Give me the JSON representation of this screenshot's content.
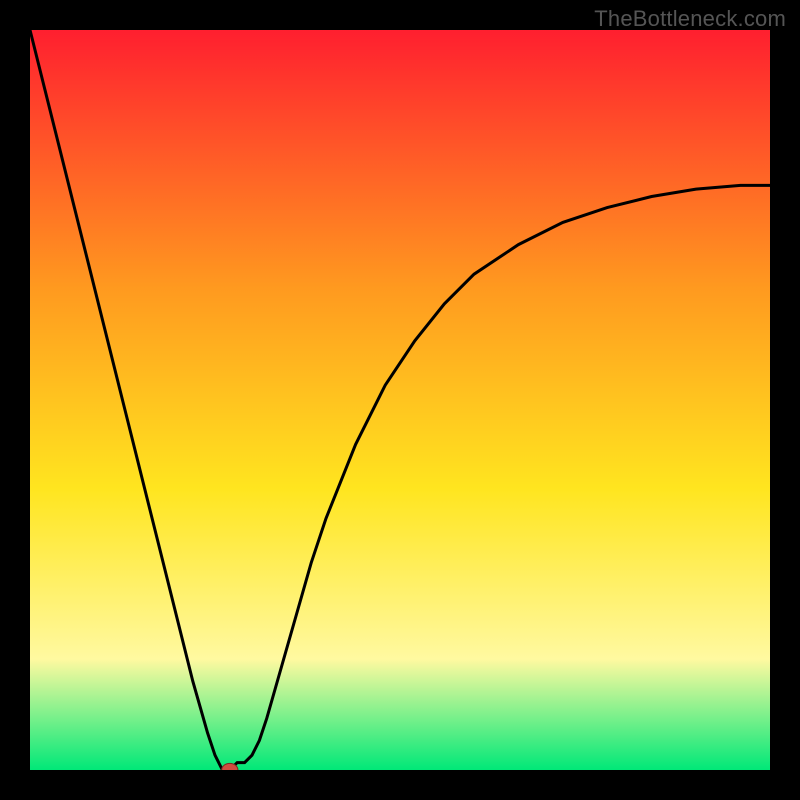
{
  "watermark": "TheBottleneck.com",
  "colors": {
    "frame": "#000000",
    "curve": "#000000",
    "marker_fill": "#cf4d3f",
    "marker_stroke": "#7a2a20",
    "gradient_top": "#ff1f2f",
    "gradient_mid_upper": "#ff9a1f",
    "gradient_mid": "#ffe51f",
    "gradient_mid_lower": "#fff9a0",
    "gradient_bottom": "#00e878"
  },
  "chart_data": {
    "type": "line",
    "title": "",
    "xlabel": "",
    "ylabel": "",
    "xlim": [
      0,
      100
    ],
    "ylim": [
      0,
      100
    ],
    "annotations": [],
    "legend": [],
    "background_gradient": {
      "direction": "vertical",
      "stops": [
        {
          "offset": 0.0,
          "color": "#ff1f2f"
        },
        {
          "offset": 0.35,
          "color": "#ff9a1f"
        },
        {
          "offset": 0.62,
          "color": "#ffe51f"
        },
        {
          "offset": 0.85,
          "color": "#fff9a0"
        },
        {
          "offset": 1.0,
          "color": "#00e878"
        }
      ]
    },
    "series": [
      {
        "name": "bottleneck-curve",
        "x": [
          0,
          2,
          4,
          6,
          8,
          10,
          12,
          14,
          16,
          18,
          20,
          22,
          24,
          25,
          26,
          27,
          28,
          29,
          30,
          31,
          32,
          34,
          36,
          38,
          40,
          44,
          48,
          52,
          56,
          60,
          66,
          72,
          78,
          84,
          90,
          96,
          100
        ],
        "y": [
          100,
          92,
          84,
          76,
          68,
          60,
          52,
          44,
          36,
          28,
          20,
          12,
          5,
          2,
          0,
          0,
          1,
          1,
          2,
          4,
          7,
          14,
          21,
          28,
          34,
          44,
          52,
          58,
          63,
          67,
          71,
          74,
          76,
          77.5,
          78.5,
          79,
          79
        ]
      }
    ],
    "marker": {
      "x": 27,
      "y": 0,
      "rx": 1.1,
      "ry": 0.9
    }
  }
}
